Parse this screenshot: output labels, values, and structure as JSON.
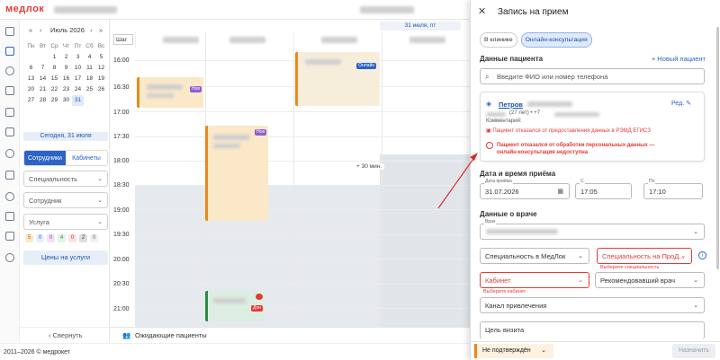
{
  "app": {
    "logo": "медлок",
    "footer": "2011–2026 © медрокет"
  },
  "calendar": {
    "month": "Июль 2026",
    "weekdays": [
      "Пн",
      "Вт",
      "Ср",
      "Чт",
      "Пт",
      "Сб",
      "Вс"
    ],
    "rows": [
      [
        "",
        "",
        "1",
        "2",
        "3",
        "4",
        "5"
      ],
      [
        "6",
        "7",
        "8",
        "9",
        "10",
        "11",
        "12"
      ],
      [
        "13",
        "14",
        "15",
        "16",
        "17",
        "18",
        "19"
      ],
      [
        "20",
        "21",
        "22",
        "23",
        "24",
        "25",
        "26"
      ],
      [
        "27",
        "28",
        "29",
        "30",
        "31",
        "",
        ""
      ]
    ],
    "today_label": "Сегодня, 31 июля"
  },
  "filters": {
    "tab_staff": "Сотрудники",
    "tab_rooms": "Кабинеты",
    "specialty": "Специальность",
    "employee": "Сотрудник",
    "service": "Услуга",
    "chips": [
      "5",
      "0",
      "0",
      "4",
      "0",
      "2",
      "0"
    ],
    "prices": "Цены на услуги",
    "collapse": "Свернуть"
  },
  "schedule": {
    "step": "Шаг",
    "date_pill": "31 июля, пт",
    "times": [
      "16:00",
      "16:30",
      "17:00",
      "17:30",
      "18:00",
      "18:30",
      "19:00",
      "19:30",
      "20:00",
      "20:30",
      "21:00"
    ],
    "plus_label": "+ 30 мин.",
    "badge_online": "Онлайн",
    "badge_new": "Нов",
    "badge_done": "Дон",
    "waiting": "Ожидающие пациенты"
  },
  "modal": {
    "title": "Запись на прием",
    "tab_clinic": "В клинике",
    "tab_online": "Онлайн-консультация",
    "patient_section": "Данные пациента",
    "new_patient": "+ Новый пациент",
    "search_placeholder": "Введите ФИО или номер телефона",
    "patient_name": "Петров",
    "patient_age": "(27 лет) • +7",
    "comment_label": "Комментарий:",
    "edit": "Ред.",
    "warn_remd": "Пациент отказался от предоставления данных в РЭМД ЕГИСЗ",
    "warn_pd": "Пациент отказался от обработки персональных данных — онлайн-консультация недоступна",
    "datetime_section": "Дата и время приёма",
    "date_label": "Дата приёма",
    "date_value": "31.07.2026",
    "from_label": "С",
    "from_value": "17:05",
    "to_label": "По",
    "to_value": "17:10",
    "doctor_section": "Данные о враче",
    "doctor_label": "Врач",
    "spec_medlok": "Специальность в МедЛок",
    "spec_prod": "Специальность на ПроД...",
    "spec_err": "Выберите специальность",
    "cabinet": "Кабинет",
    "cabinet_err": "Выберите кабинет",
    "referrer": "Рекомендовавший врач",
    "channel": "Канал привлечения",
    "goal": "Цель визита",
    "status": "Не подтверждён",
    "assign": "Назначить"
  },
  "colors": {
    "accent": "#2b64c7",
    "error": "#e53935",
    "warning": "#e8891e"
  }
}
